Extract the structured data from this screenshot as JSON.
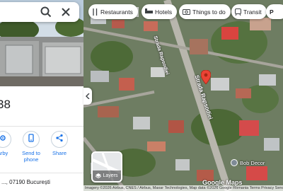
{
  "panel": {
    "place_number": "38",
    "address": "07190 București",
    "address_prefix": "...,",
    "actions": [
      {
        "label": "arby",
        "icon": "nearby-icon"
      },
      {
        "label": "Send to phone",
        "icon": "phone-icon"
      },
      {
        "label": "Share",
        "icon": "share-icon"
      }
    ]
  },
  "chips": [
    {
      "label": "Restaurants",
      "icon": "restaurant-icon"
    },
    {
      "label": "Hotels",
      "icon": "hotel-icon"
    },
    {
      "label": "Things to do",
      "icon": "camera-icon"
    },
    {
      "label": "Transit",
      "icon": "transit-icon"
    },
    {
      "label": "P",
      "icon": "parking-icon"
    }
  ],
  "map": {
    "street_1": "Strada Rapsodiei",
    "street_2": "Strada Rapsodiei",
    "poi": "Bob Decor",
    "layers_label": "Layers",
    "google_logo": "Google Maps",
    "attribution": "Imagery ©2026 Airbus, CNES / Airbus, Maxar Technologies, Map data ©2026 Google   Romania   Terms   Privacy   Send Product Feedback   20 m",
    "accent_color": "#ea4335"
  }
}
